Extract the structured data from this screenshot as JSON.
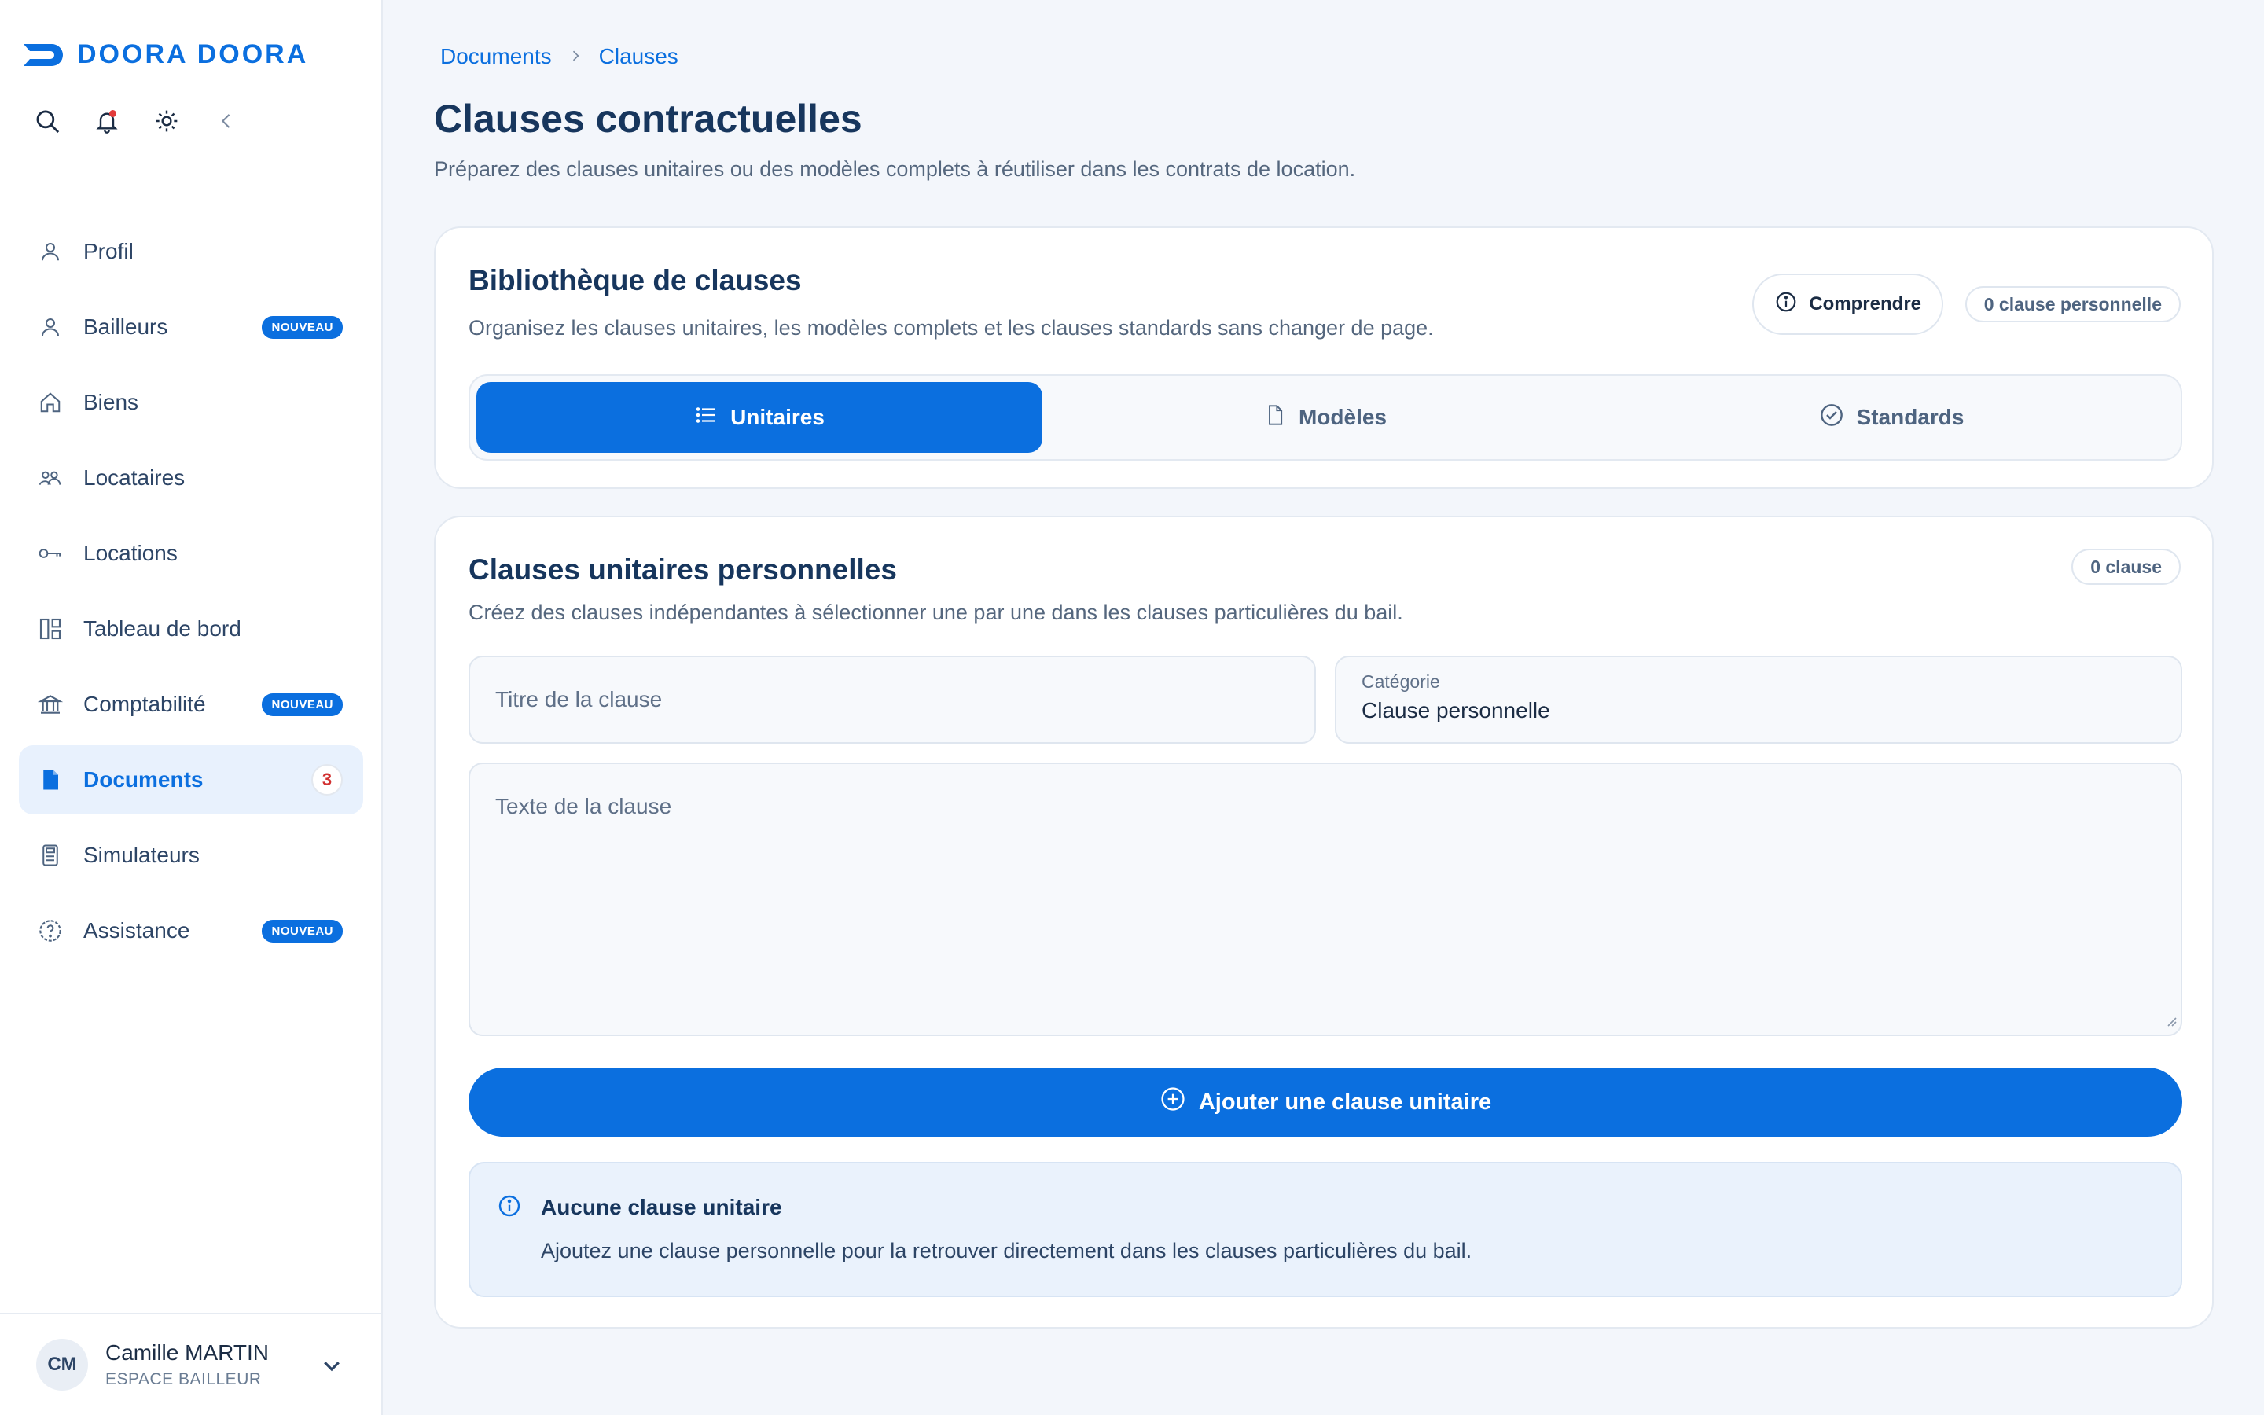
{
  "brand": {
    "name": "DOORA DOORA",
    "color": "#0b6fdf"
  },
  "toolbar": {
    "icons": [
      "search-icon",
      "bell-icon",
      "sun-icon",
      "collapse-icon"
    ]
  },
  "sidebar": {
    "items": [
      {
        "label": "Profil",
        "icon": "user-icon"
      },
      {
        "label": "Bailleurs",
        "icon": "user-icon",
        "badge": "NOUVEAU"
      },
      {
        "label": "Biens",
        "icon": "home-icon"
      },
      {
        "label": "Locataires",
        "icon": "users-icon"
      },
      {
        "label": "Locations",
        "icon": "key-icon"
      },
      {
        "label": "Tableau de bord",
        "icon": "dashboard-icon"
      },
      {
        "label": "Comptabilité",
        "icon": "bank-icon",
        "badge": "NOUVEAU"
      },
      {
        "label": "Documents",
        "icon": "document-icon",
        "count": "3",
        "active": true
      },
      {
        "label": "Simulateurs",
        "icon": "calculator-icon"
      },
      {
        "label": "Assistance",
        "icon": "help-icon",
        "badge": "NOUVEAU"
      }
    ]
  },
  "user": {
    "initials": "CM",
    "name": "Camille MARTIN",
    "role": "ESPACE BAILLEUR"
  },
  "breadcrumb": {
    "parent": "Documents",
    "current": "Clauses"
  },
  "page": {
    "title": "Clauses contractuelles",
    "subtitle": "Préparez des clauses unitaires ou des modèles complets à réutiliser dans les contrats de location."
  },
  "library": {
    "title": "Bibliothèque de clauses",
    "subtitle": "Organisez les clauses unitaires, les modèles complets et les clauses standards sans changer de page.",
    "understand_label": "Comprendre",
    "count_label": "0 clause personnelle",
    "tabs": [
      {
        "label": "Unitaires",
        "icon": "list-icon",
        "active": true
      },
      {
        "label": "Modèles",
        "icon": "file-icon",
        "active": false
      },
      {
        "label": "Standards",
        "icon": "check-circle-icon",
        "active": false
      }
    ]
  },
  "unit_clauses": {
    "title": "Clauses unitaires personnelles",
    "subtitle": "Créez des clauses indépendantes à sélectionner une par une dans les clauses particulières du bail.",
    "count_label": "0 clause",
    "title_placeholder": "Titre de la clause",
    "category_label": "Catégorie",
    "category_value": "Clause personnelle",
    "text_placeholder": "Texte de la clause",
    "add_label": "Ajouter une clause unitaire",
    "empty_title": "Aucune clause unitaire",
    "empty_text": "Ajoutez une clause personnelle pour la retrouver directement dans les clauses particulières du bail."
  }
}
